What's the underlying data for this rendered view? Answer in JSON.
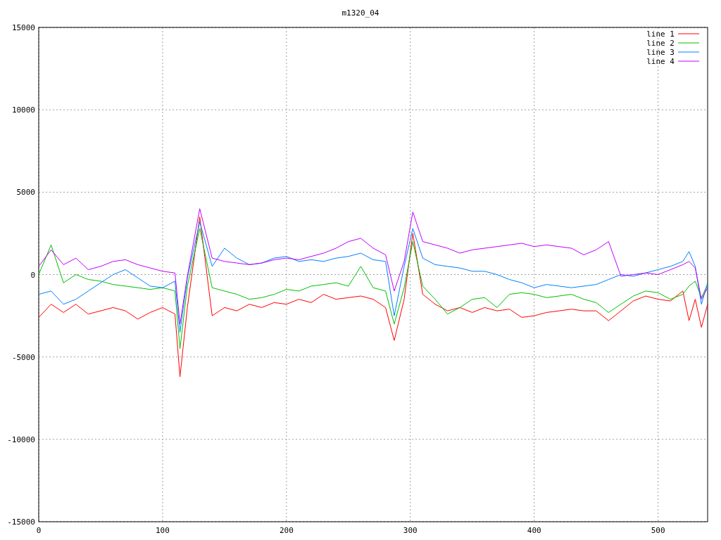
{
  "chart_data": {
    "type": "line",
    "title": "m1320_04",
    "grid": true,
    "legend": true,
    "xlim": [
      0,
      540
    ],
    "ylim": [
      -15000,
      15000
    ],
    "xticks": [
      0,
      100,
      200,
      300,
      400,
      500
    ],
    "yticks": [
      -15000,
      -10000,
      -5000,
      0,
      5000,
      10000,
      15000
    ],
    "x": [
      0,
      10,
      20,
      30,
      40,
      50,
      60,
      70,
      80,
      90,
      100,
      110,
      114,
      120,
      130,
      140,
      150,
      160,
      170,
      180,
      190,
      200,
      210,
      220,
      230,
      240,
      250,
      260,
      270,
      280,
      287,
      295,
      302,
      310,
      320,
      330,
      340,
      350,
      360,
      370,
      380,
      390,
      400,
      410,
      420,
      430,
      440,
      450,
      460,
      470,
      480,
      490,
      500,
      510,
      520,
      525,
      530,
      535,
      540
    ],
    "series": [
      {
        "name": "line 1",
        "color": "#ff0000",
        "values": [
          -2600,
          -1800,
          -2300,
          -1800,
          -2400,
          -2200,
          -2000,
          -2200,
          -2700,
          -2300,
          -2000,
          -2400,
          -6200,
          -2000,
          3500,
          -2500,
          -2000,
          -2200,
          -1800,
          -2000,
          -1700,
          -1800,
          -1500,
          -1700,
          -1200,
          -1500,
          -1400,
          -1300,
          -1500,
          -2000,
          -4000,
          -1500,
          2500,
          -1200,
          -1800,
          -2200,
          -2000,
          -2300,
          -2000,
          -2200,
          -2100,
          -2600,
          -2500,
          -2300,
          -2200,
          -2100,
          -2200,
          -2200,
          -2800,
          -2200,
          -1600,
          -1300,
          -1500,
          -1600,
          -1000,
          -2800,
          -1500,
          -3200,
          -1800
        ]
      },
      {
        "name": "line 2",
        "color": "#00c000",
        "values": [
          0,
          1800,
          -500,
          0,
          -300,
          -400,
          -600,
          -700,
          -800,
          -900,
          -800,
          -1000,
          -4500,
          -700,
          2800,
          -800,
          -1000,
          -1200,
          -1500,
          -1400,
          -1200,
          -900,
          -1000,
          -700,
          -600,
          -500,
          -700,
          500,
          -800,
          -1000,
          -3000,
          -800,
          2000,
          -700,
          -1500,
          -2400,
          -2000,
          -1500,
          -1400,
          -2000,
          -1200,
          -1100,
          -1200,
          -1400,
          -1300,
          -1200,
          -1500,
          -1700,
          -2300,
          -1800,
          -1300,
          -1000,
          -1100,
          -1500,
          -1200,
          -700,
          -400,
          -1400,
          -600
        ]
      },
      {
        "name": "line 3",
        "color": "#0080ff",
        "values": [
          -1200,
          -1000,
          -1800,
          -1500,
          -1000,
          -500,
          0,
          300,
          -200,
          -700,
          -800,
          -400,
          -3500,
          -200,
          3200,
          500,
          1600,
          1000,
          600,
          700,
          1000,
          1100,
          800,
          900,
          800,
          1000,
          1100,
          1300,
          900,
          800,
          -2500,
          500,
          2800,
          1000,
          600,
          500,
          400,
          200,
          200,
          0,
          -300,
          -500,
          -800,
          -600,
          -700,
          -800,
          -700,
          -600,
          -300,
          0,
          -100,
          100,
          300,
          500,
          800,
          1400,
          500,
          -1800,
          -500
        ]
      },
      {
        "name": "line 4",
        "color": "#c000ff",
        "values": [
          500,
          1500,
          600,
          1000,
          300,
          500,
          800,
          900,
          600,
          400,
          200,
          100,
          -3000,
          -100,
          4000,
          1000,
          800,
          700,
          600,
          700,
          900,
          1000,
          900,
          1100,
          1300,
          1600,
          2000,
          2200,
          1600,
          1200,
          -1000,
          800,
          3800,
          2000,
          1800,
          1600,
          1300,
          1500,
          1600,
          1700,
          1800,
          1900,
          1700,
          1800,
          1700,
          1600,
          1200,
          1500,
          2000,
          -100,
          0,
          100,
          0,
          300,
          600,
          800,
          400,
          -1500,
          -800
        ]
      }
    ]
  }
}
